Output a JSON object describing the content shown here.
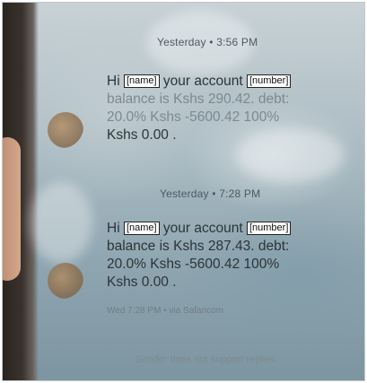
{
  "messages": [
    {
      "timestamp": "Yesterday • 3:56 PM",
      "line1_prefix": "Hi",
      "name_tag": "[name]",
      "line1_mid": "your account",
      "number_tag": "[number]",
      "line2": "balance is Kshs 290.42. debt:",
      "line3": "20.0% Kshs -5600.42  100%",
      "line4": "Kshs 0.00 ."
    },
    {
      "timestamp": "Yesterday • 7:28 PM",
      "line1_prefix": "Hi",
      "name_tag": "[name]",
      "line1_mid": "your account",
      "number_tag": "[number]",
      "line2": "balance is Kshs 287.43. debt:",
      "line3": "20.0% Kshs -5600.42  100%",
      "line4": "Kshs 0.00 ."
    }
  ],
  "meta_line": "Wed 7:28 PM • via Safaricom",
  "footer_note": "Sender does not support replies"
}
